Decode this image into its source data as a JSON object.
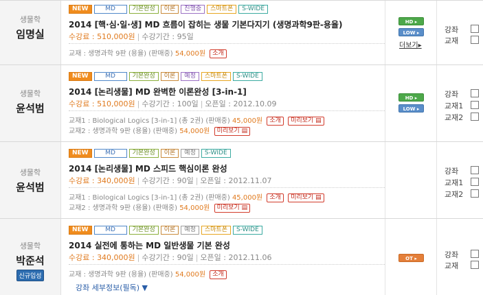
{
  "courses": [
    {
      "subject": "생물학",
      "teacher": "임명실",
      "tags": [
        "NEW",
        "MD",
        "기본완성",
        "이론",
        "진행중",
        "스마트폰",
        "S-WIDE"
      ],
      "title": "2014 [핵·심·일·생] MD 흐름이 잡히는 생물 기본다지기 (생명과학9판-용율)",
      "price_label": "수강료 :",
      "price": "510,000원",
      "period": "수강기간 : 95일",
      "books": [
        {
          "label": "교재 : 생명과학 9판 (용율) (판매중)",
          "price": "54,000원",
          "actions": [
            "소개"
          ]
        }
      ],
      "buttons": [
        "HD",
        "LOW"
      ],
      "more": "더보기",
      "checks": [
        "강좌",
        "교재"
      ]
    },
    {
      "subject": "생물학",
      "teacher": "윤석범",
      "tags": [
        "NEW",
        "MD",
        "기본완성",
        "이론",
        "예정",
        "스마트폰",
        "S-WIDE"
      ],
      "title": "2014 [논리생물] MD 완벽한 이론완성 [3-in-1]",
      "price_label": "수강료 :",
      "price": "510,000원",
      "period": "수강기간 : 100일",
      "open": "오픈일 : 2012.10.09",
      "books": [
        {
          "label": "교재1 : Biological Logics [3-in-1] (총 2권) (판매중)",
          "price": "45,000원",
          "actions": [
            "소개",
            "미리보기"
          ]
        },
        {
          "label": "교재2 : 생명과학 9판 (용율) (판매중)",
          "price": "54,000원",
          "actions": [
            "미리보기"
          ]
        }
      ],
      "buttons": [
        "HD",
        "LOW"
      ],
      "checks": [
        "강좌",
        "교재1",
        "교재2"
      ]
    },
    {
      "subject": "생물학",
      "teacher": "윤석범",
      "tags": [
        "NEW",
        "MD",
        "기본완성",
        "이론",
        "예정",
        "S-WIDE"
      ],
      "title": "2014 [논리생물] MD 스피드 핵심이론 완성",
      "price_label": "수강료 :",
      "price": "340,000원",
      "period": "수강기간 : 90일",
      "open": "오픈일 : 2012.11.07",
      "books": [
        {
          "label": "교재1 : Biological Logics [3-in-1] (총 2권) (판매중)",
          "price": "45,000원",
          "actions": [
            "소개",
            "미리보기"
          ]
        },
        {
          "label": "교재2 : 생명과학 9판 (용율) (판매중)",
          "price": "54,000원",
          "actions": [
            "미리보기"
          ]
        }
      ],
      "buttons": [],
      "checks": [
        "강좌",
        "교재1",
        "교재2"
      ]
    },
    {
      "subject": "생물학",
      "teacher": "박준석",
      "badge": "신규입성",
      "tags": [
        "NEW",
        "MD",
        "기본완성",
        "이론",
        "예정",
        "스마트폰",
        "S-WIDE"
      ],
      "title": "2014 실전에 통하는 MD 일반생물 기본 완성",
      "price_label": "수강료 :",
      "price": "340,000원",
      "period": "수강기간 : 90일",
      "open": "오픈일 : 2012.11.06",
      "books": [
        {
          "label": "교재 : 생명과학 9판 (용율) (판매중)",
          "price": "54,000원",
          "actions": [
            "소개"
          ]
        }
      ],
      "detail_link": "강좌 세부정보(필독) ▼",
      "buttons": [
        "OT"
      ],
      "checks": [
        "강좌",
        "교재"
      ]
    }
  ]
}
